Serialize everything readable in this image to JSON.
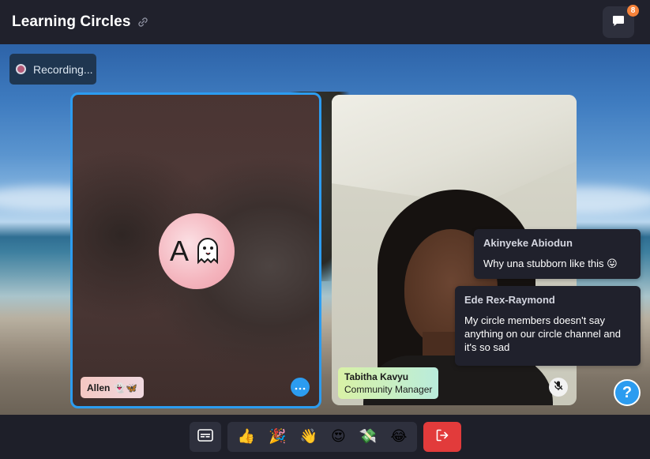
{
  "header": {
    "title": "Learning Circles",
    "chat_badge_count": "8"
  },
  "recording": {
    "label": "Recording..."
  },
  "participants": [
    {
      "name": "Allen",
      "name_emoji": "👻🦋",
      "avatar_letter": "A",
      "avatar_emoji": "👻",
      "speaking": true
    },
    {
      "name": "Tabitha Kavyu",
      "role": "Community Manager",
      "muted": true
    }
  ],
  "chat_messages": [
    {
      "author": "Akinyeke Abiodun",
      "text": "Why una stubborn like this 😛"
    },
    {
      "author": "Ede Rex-Raymond",
      "text": "My circle members doesn't say anything on our circle channel and it's so sad"
    }
  ],
  "help": {
    "label": "?"
  },
  "reactions": [
    "👍",
    "🎉",
    "👋",
    "😍",
    "💸",
    "😂"
  ],
  "colors": {
    "accent": "#2c9cf0",
    "badge": "#f5823a",
    "leave": "#e23b3b",
    "recording_bg": "#1f3650"
  }
}
